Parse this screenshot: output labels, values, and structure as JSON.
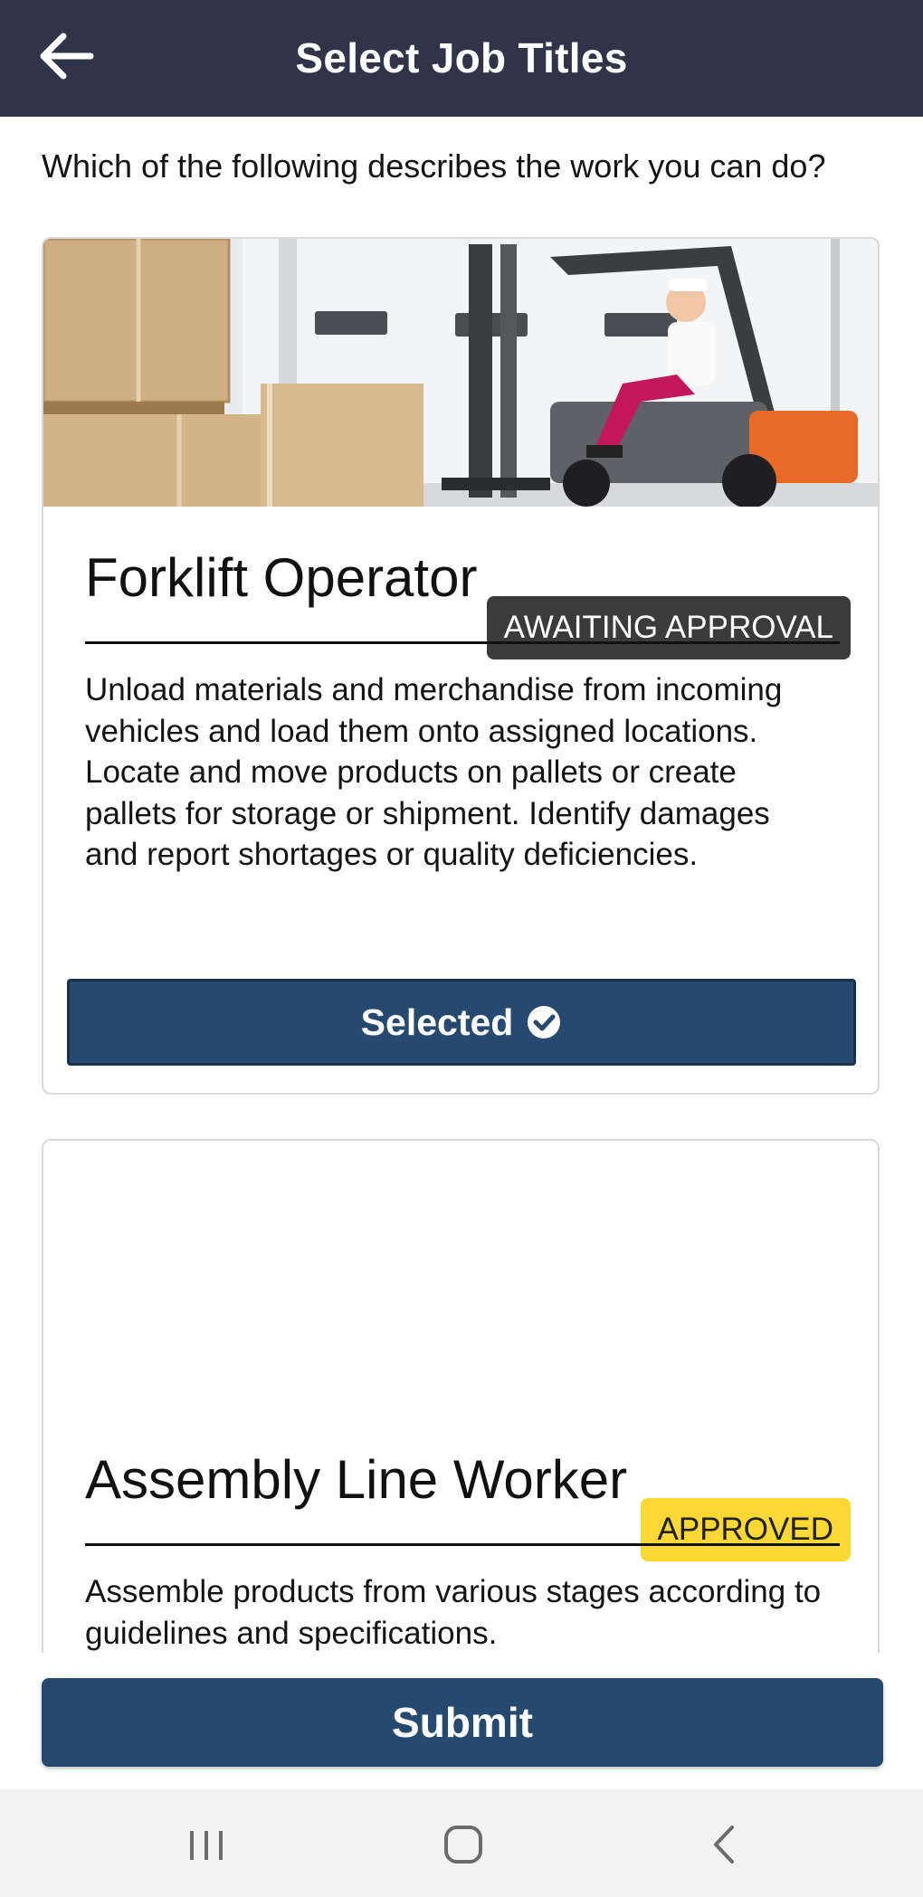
{
  "header": {
    "title": "Select Job Titles",
    "back_icon": "arrow-left-icon"
  },
  "question": "Which of the following describes the work you can do?",
  "jobs": [
    {
      "image": "forklift-photo",
      "status": "AWAITING APPROVAL",
      "title": "Forklift Operator",
      "description": "Unload materials and merchandise from incoming vehicles and load them onto assigned locations. Locate and move products on pallets or create pallets for storage or shipment. Identify damages and report shortages or quality deficiencies.",
      "button_label": "Selected",
      "button_icon": "check-circle-icon"
    },
    {
      "status": "APPROVED",
      "title": "Assembly Line Worker",
      "description": "Assemble products from various stages according to guidelines and specifications."
    }
  ],
  "submit_label": "Submit",
  "system_nav": {
    "recents": "recents-icon",
    "home": "home-icon",
    "back": "back-chevron-icon"
  },
  "colors": {
    "header_bg": "#2f3448",
    "primary": "#26496f",
    "awaiting_badge": "#3b3b3b",
    "approved_badge": "#fdd835"
  }
}
